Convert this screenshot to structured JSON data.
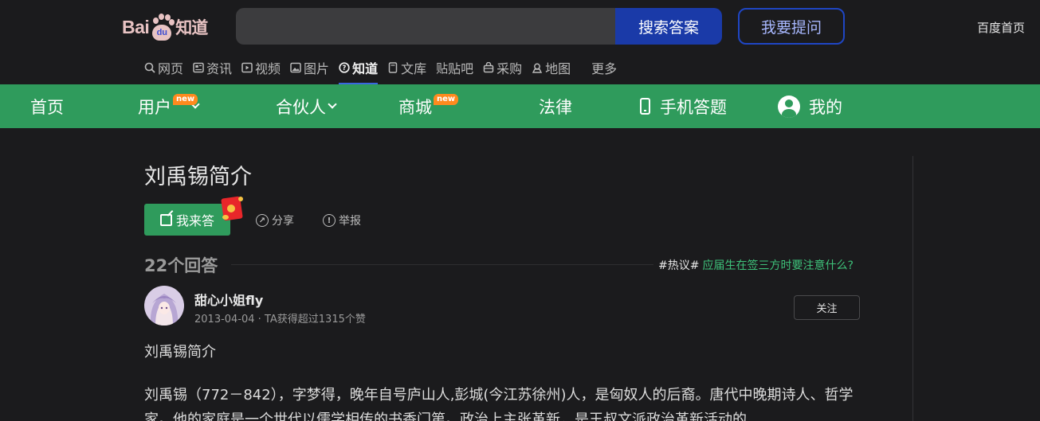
{
  "header": {
    "logo": {
      "bai": "Bai",
      "du": "du",
      "zhidao": "知道"
    },
    "search": {
      "value": "",
      "button": "搜索答案"
    },
    "ask_button": "我要提问",
    "home_link": "百度首页"
  },
  "subnav": {
    "items": [
      {
        "label": "网页",
        "icon": "search-icon"
      },
      {
        "label": "资讯",
        "icon": "news-icon"
      },
      {
        "label": "视频",
        "icon": "video-icon"
      },
      {
        "label": "图片",
        "icon": "image-icon"
      },
      {
        "label": "知道",
        "icon": "question-icon",
        "active": true
      },
      {
        "label": "文库",
        "icon": "doc-icon"
      },
      {
        "label": "贴吧",
        "icon": "tieba-icon"
      },
      {
        "label": "采购",
        "icon": "bag-icon"
      },
      {
        "label": "地图",
        "icon": "map-icon"
      }
    ],
    "more": "更多"
  },
  "greennav": {
    "home": "首页",
    "user": "用户",
    "partner": "合伙人",
    "mall": "商城",
    "law": "法律",
    "mobile": "手机答题",
    "mine": "我的",
    "badge": "new"
  },
  "question": {
    "title": "刘禹锡简介",
    "answer_button": "我来答",
    "share": "分享",
    "report": "举报"
  },
  "answers": {
    "count": "22个回答",
    "hot_tag": "#热议#",
    "hot_link": "应届生在签三方时要注意什么?"
  },
  "first_answer": {
    "username": "甜心小姐fly",
    "meta": "2013-04-04 · TA获得超过1315个赞",
    "follow": "关注",
    "heading": "刘禹锡简介",
    "body": "刘禹锡（772－842），字梦得，晚年自号庐山人,彭城(今江苏徐州)人，是匈奴人的后裔。唐代中晚期诗人、哲学家。他的家庭是一个世代以儒学相传的书香门第。政治上主张革新，是王叔文派政治革新活动的"
  },
  "colors": {
    "background": "#1b1b1d",
    "green": "#2f9b5c",
    "search_blue": "#1a3aa8",
    "hot_link": "#3ec27a"
  }
}
